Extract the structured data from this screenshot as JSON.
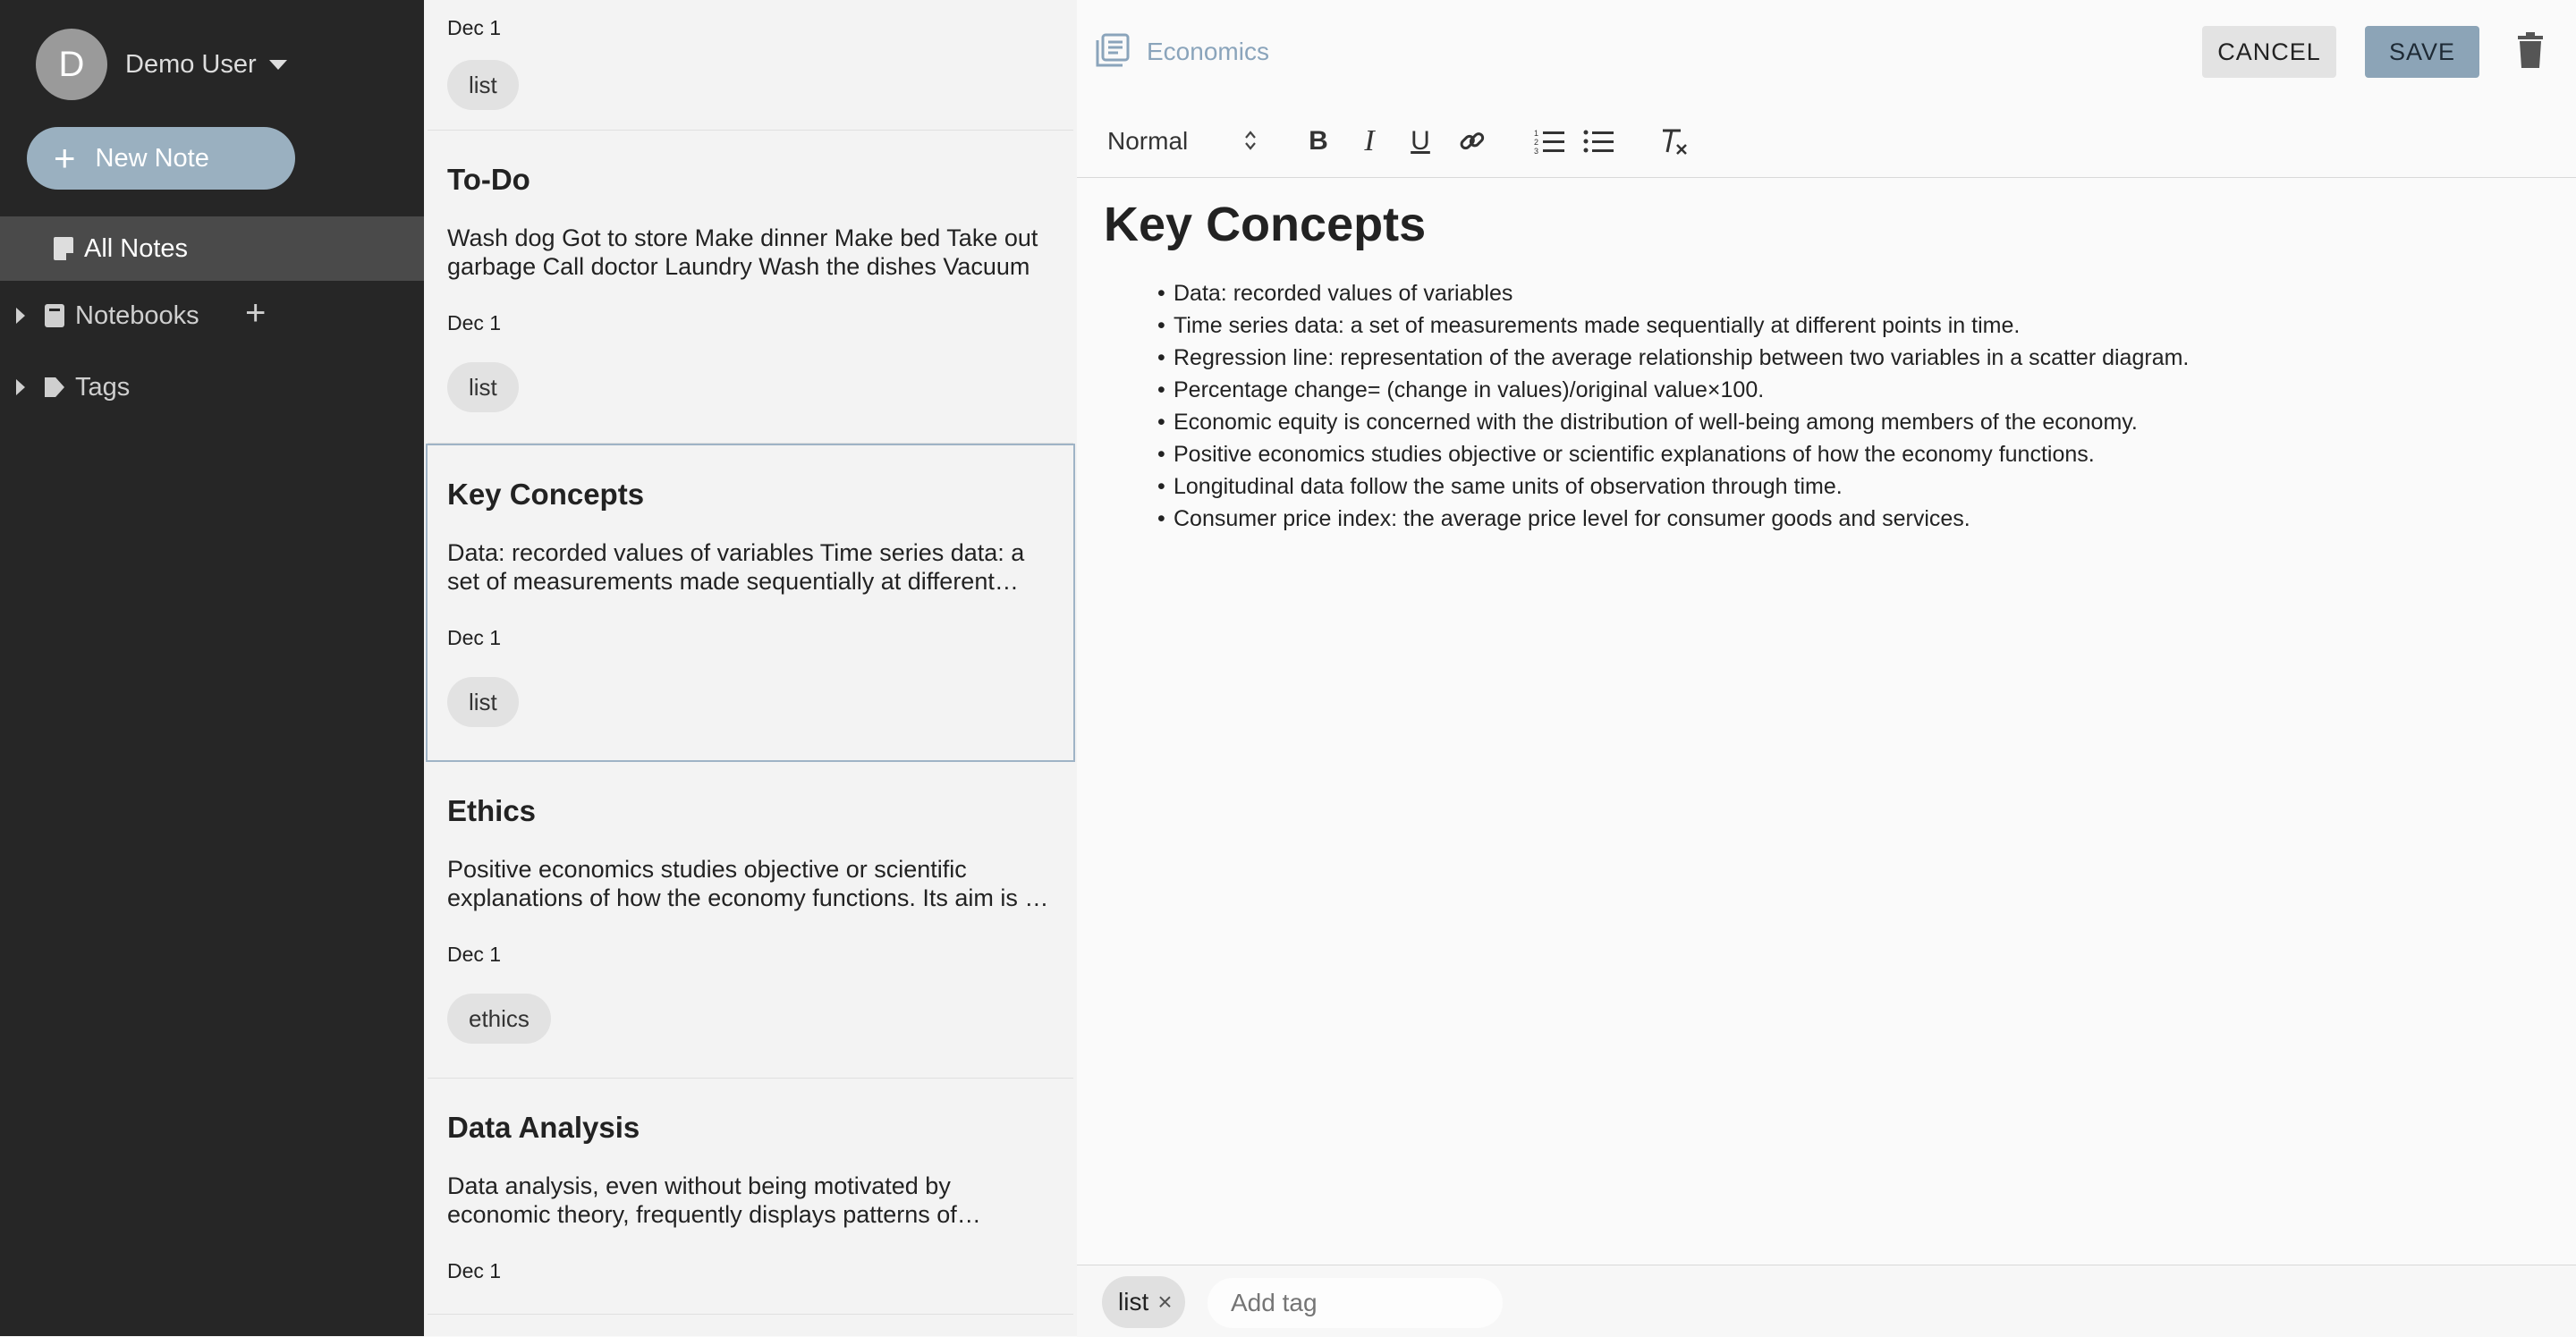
{
  "sidebar": {
    "user": {
      "initial": "D",
      "name": "Demo User"
    },
    "new_note_label": "New Note",
    "all_notes_label": "All Notes",
    "notebooks_label": "Notebooks",
    "tags_label": "Tags"
  },
  "notes": [
    {
      "title": "",
      "snippet": "",
      "date": "Dec 1",
      "tag": "list"
    },
    {
      "title": "To-Do",
      "snippet": "Wash dog Got to store Make dinner Make bed Take out garbage Call doctor Laundry Wash the dishes Vacuum",
      "date": "Dec 1",
      "tag": "list"
    },
    {
      "title": "Key Concepts",
      "snippet": "Data: recorded values of variables Time series data: a set of measurements made sequentially at different points in time.",
      "date": "Dec 1",
      "tag": "list",
      "selected": true
    },
    {
      "title": "Ethics",
      "snippet": "Positive economics studies objective or scientific explanations of how the economy functions. Its aim is to understand",
      "date": "Dec 1",
      "tag": "ethics"
    },
    {
      "title": "Data Analysis",
      "snippet": "Data analysis, even without being motivated by economic theory, frequently displays patterns of behavior",
      "date": "Dec 1",
      "tag": ""
    }
  ],
  "editor": {
    "notebook": "Economics",
    "cancel_label": "CANCEL",
    "save_label": "SAVE",
    "format_select": "Normal",
    "title": "Key Concepts",
    "items": [
      "Data: recorded values of variables",
      "Time series data: a set of measurements made sequentially at different points in time.",
      "Regression line: representation of the average relationship between two variables in a scatter diagram.",
      "Percentage change= (change in values)/original value×100.",
      "Economic equity is concerned with the distribution of well-being among members of the economy.",
      "Positive economics studies objective or scientific explanations of how the economy functions.",
      "Longitudinal data follow the same units of observation through time.",
      "Consumer price index: the average price level for consumer goods and services."
    ],
    "tag": "list",
    "tag_remove": "×",
    "add_tag_placeholder": "Add tag"
  },
  "colors": {
    "sidebar_bg": "#262626",
    "accent": "#9ab0c0",
    "save_bg": "#8ca4b7",
    "selected_border": "#9fb3c6"
  }
}
